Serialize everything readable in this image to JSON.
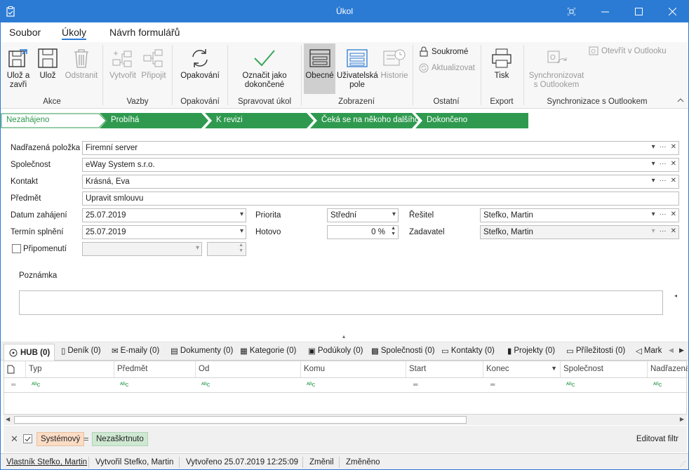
{
  "window": {
    "title": "Úkol"
  },
  "menu": {
    "file": "Soubor",
    "tasks": "Úkoly",
    "designer": "Návrh formulářů"
  },
  "ribbon": {
    "save_close": "Ulož a zavři",
    "save": "Ulož",
    "delete": "Odstranit",
    "group_actions": "Akce",
    "create": "Vytvořit",
    "attach": "Připojit",
    "group_links": "Vazby",
    "repeat": "Opakování",
    "group_repeat": "Opakování",
    "mark_done": "Označit jako dokončené",
    "group_manage": "Spravovat úkol",
    "general": "Obecné",
    "user_fields": "Uživatelská pole",
    "history": "Historie",
    "group_view": "Zobrazení",
    "private": "Soukromé",
    "update": "Aktualizovat",
    "group_other": "Ostatní",
    "print": "Tisk",
    "group_export": "Export",
    "sync": "Synchronizovat s Outlookem",
    "open_outlook": "Otevřít v Outlooku",
    "group_sync": "Synchronizace s Outlookem"
  },
  "stages": [
    "Nezahájeno",
    "Probíhá",
    "K revizi",
    "Čeká se na někoho dalšího",
    "Dokončeno"
  ],
  "form": {
    "parent_label": "Nadřazená položka",
    "parent_value": "Firemní server",
    "company_label": "Společnost",
    "company_value": "eWay System s.r.o.",
    "contact_label": "Kontakt",
    "contact_value": "Krásná, Eva",
    "subject_label": "Předmět",
    "subject_value": "Upravit smlouvu",
    "start_label": "Datum zahájení",
    "start_value": "25.07.2019",
    "due_label": "Termín splnění",
    "due_value": "25.07.2019",
    "remind_label": "Připomenutí",
    "priority_label": "Priorita",
    "priority_value": "Střední",
    "done_label": "Hotovo",
    "done_value": "0 %",
    "solver_label": "Řešitel",
    "solver_value": "Stefko, Martin",
    "requester_label": "Zadavatel",
    "requester_value": "Stefko, Martin",
    "note_label": "Poznámka"
  },
  "hub_tabs": [
    "HUB (0)",
    "Deník (0)",
    "E-maily (0)",
    "Dokumenty (0)",
    "Kategorie (0)",
    "Podúkoly (0)",
    "Společnosti (0)",
    "Kontakty (0)",
    "Projekty (0)",
    "Příležitosti (0)",
    "Mark"
  ],
  "grid_columns": [
    "Typ",
    "Předmět",
    "Od",
    "Komu",
    "Start",
    "Konec",
    "Společnost",
    "Nadřazená"
  ],
  "filter": {
    "system": "Systémový",
    "eq": "=",
    "value": "Nezaškrtnuto",
    "edit": "Editovat filtr"
  },
  "status": {
    "owner": "Vlastník Stefko, Martin",
    "created_by": "Vytvořil Stefko, Martin",
    "created": "Vytvořeno 25.07.2019 12:25:09",
    "changed_by": "Změnil",
    "changed": "Změněno"
  },
  "colors": {
    "accent": "#2b7bd4",
    "stage_green": "#2f9a4f"
  }
}
